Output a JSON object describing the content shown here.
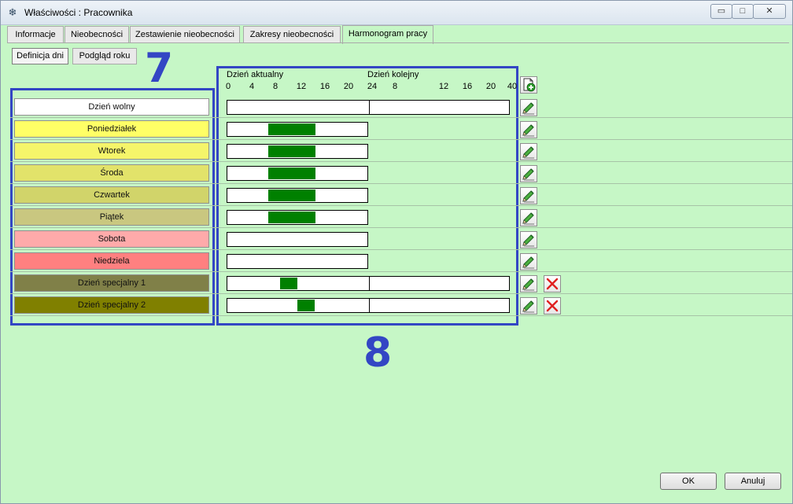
{
  "window": {
    "title": "Właściwości : Pracownika",
    "controls": {
      "minimize": "▭",
      "maximize": "□",
      "close": "✕"
    }
  },
  "tabs": [
    {
      "label": "Informacje"
    },
    {
      "label": "Nieobecności"
    },
    {
      "label": "Zestawienie nieobecności"
    },
    {
      "label": "Zakresy nieobecności"
    },
    {
      "label": "Harmonogram pracy",
      "active": true
    }
  ],
  "subtabs": [
    {
      "label": "Definicja dni",
      "active": true
    },
    {
      "label": "Podgląd roku"
    }
  ],
  "annotations": {
    "list_number": "7",
    "chart_number": "8",
    "color": "#3346c4"
  },
  "scale": {
    "current_day_label": "Dzień aktualny",
    "next_day_label": "Dzień kolejny",
    "ticks": [
      "0",
      "4",
      "8",
      "12",
      "16",
      "20",
      "24",
      "8",
      "12",
      "16",
      "20",
      "40"
    ]
  },
  "days": [
    {
      "label": "Dzień wolny",
      "color": "#ffffff",
      "span_hours": 48,
      "work": []
    },
    {
      "label": "Poniedziałek",
      "color": "#ffff66",
      "span_hours": 24,
      "work": [
        [
          7,
          15
        ]
      ]
    },
    {
      "label": "Wtorek",
      "color": "#f5f56a",
      "span_hours": 24,
      "work": [
        [
          7,
          15
        ]
      ]
    },
    {
      "label": "Środa",
      "color": "#e2e36a",
      "span_hours": 24,
      "work": [
        [
          7,
          15
        ]
      ]
    },
    {
      "label": "Czwartek",
      "color": "#d1d46a",
      "span_hours": 24,
      "work": [
        [
          7,
          15
        ]
      ]
    },
    {
      "label": "Piątek",
      "color": "#c9c780",
      "span_hours": 24,
      "work": [
        [
          7,
          15
        ]
      ]
    },
    {
      "label": "Sobota",
      "color": "#ffaaaa",
      "span_hours": 24,
      "work": []
    },
    {
      "label": "Niedziela",
      "color": "#ff8080",
      "span_hours": 24,
      "work": []
    },
    {
      "label": "Dzień specjalny 1",
      "color": "#808048",
      "span_hours": 48,
      "work": [
        [
          9,
          12
        ]
      ],
      "deletable": true
    },
    {
      "label": "Dzień specjalny 2",
      "color": "#808000",
      "span_hours": 48,
      "work": [
        [
          12,
          15
        ]
      ],
      "deletable": true
    }
  ],
  "icons": {
    "add": "add-document-icon",
    "edit": "pencil-edit-icon",
    "delete": "red-x-delete-icon"
  },
  "buttons": {
    "ok": "OK",
    "cancel": "Anuluj"
  }
}
